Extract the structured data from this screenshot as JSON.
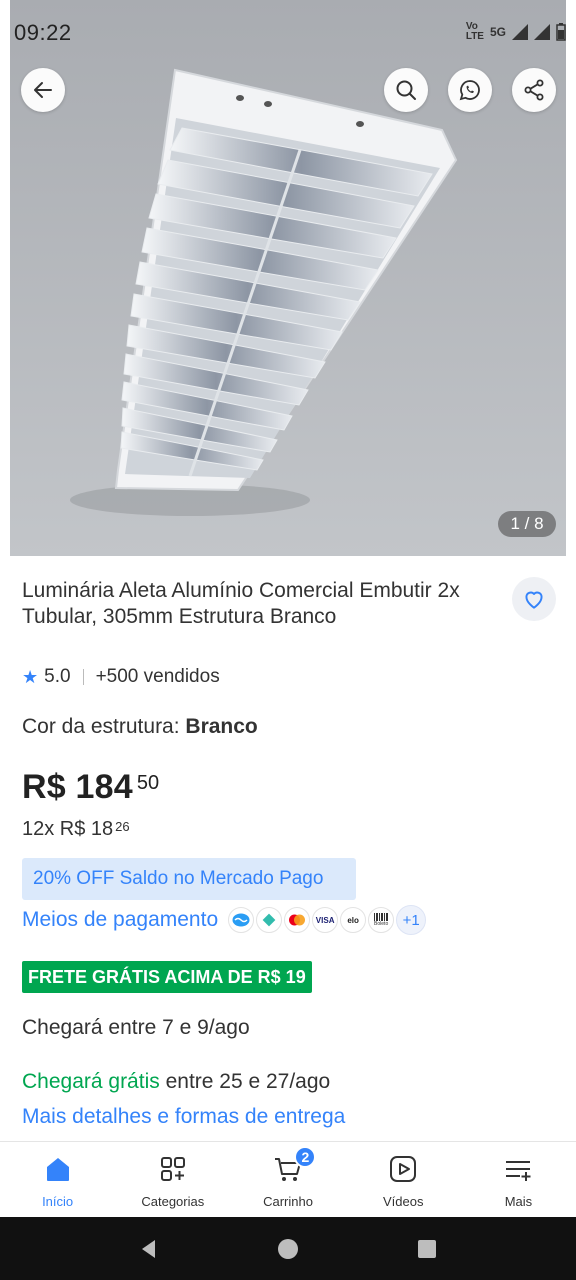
{
  "status_bar": {
    "time": "09:22",
    "volte_top": "Vo",
    "volte_bottom": "LTE",
    "network": "5G"
  },
  "gallery": {
    "counter": "1 / 8"
  },
  "header_actions": {
    "back_icon": "arrow-left-icon",
    "search_icon": "search-icon",
    "whatsapp_icon": "whatsapp-icon",
    "share_icon": "share-icon"
  },
  "product": {
    "title": "Luminária Aleta Alumínio Comercial Embutir 2x Tubular, 305mm Estrutura Branco",
    "rating": "5.0",
    "sold": "+500 vendidos",
    "variant_label": "Cor da estrutura: ",
    "variant_value": "Branco",
    "price_main": "R$ 184",
    "price_cents": "50",
    "installments_main": "12x R$ 18",
    "installments_cents": "26",
    "promo": "20% OFF Saldo no Mercado Pago",
    "payment_link": "Meios de pagamento",
    "payment_more": "+1",
    "payment_visa": "VISA",
    "payment_elo": "elo",
    "payment_boleto": "Boleto",
    "free_shipping_badge": "FRETE GRÁTIS ACIMA DE R$ 19",
    "delivery_1": "Chegará entre 7 e 9/ago",
    "delivery_2_green": "Chegará grátis",
    "delivery_2_rest": " entre 25 e 27/ago",
    "more_details": "Mais detalhes e formas de entrega"
  },
  "bottom_nav": {
    "items": [
      {
        "label": "Início",
        "icon": "home-icon"
      },
      {
        "label": "Categorias",
        "icon": "categories-icon"
      },
      {
        "label": "Carrinho",
        "icon": "cart-icon"
      },
      {
        "label": "Vídeos",
        "icon": "video-icon"
      },
      {
        "label": "Mais",
        "icon": "menu-icon"
      }
    ],
    "cart_count": "2"
  },
  "colors": {
    "accent": "#3483fa",
    "green": "#00a650",
    "promo_bg": "#dbe9fb"
  }
}
